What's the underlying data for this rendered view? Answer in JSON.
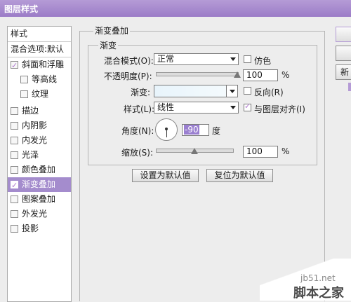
{
  "window": {
    "title": "图层样式"
  },
  "sidebar": {
    "header": "样式",
    "blend_options": "混合选项:默认",
    "items": [
      {
        "label": "斜面和浮雕",
        "checked": true
      },
      {
        "label": "等高线",
        "checked": false
      },
      {
        "label": "纹理",
        "checked": false
      },
      {
        "label": "描边",
        "checked": false
      },
      {
        "label": "内阴影",
        "checked": false
      },
      {
        "label": "内发光",
        "checked": false
      },
      {
        "label": "光泽",
        "checked": false
      },
      {
        "label": "颜色叠加",
        "checked": false
      },
      {
        "label": "渐变叠加",
        "checked": true,
        "selected": true
      },
      {
        "label": "图案叠加",
        "checked": false
      },
      {
        "label": "外发光",
        "checked": false
      },
      {
        "label": "投影",
        "checked": false
      }
    ]
  },
  "panel": {
    "title": "渐变叠加",
    "subtitle": "渐变",
    "blend_mode_label": "混合模式(O):",
    "blend_mode_value": "正常",
    "dither_label": "仿色",
    "dither_checked": false,
    "opacity_label": "不透明度(P):",
    "opacity_value": "100",
    "opacity_unit": "%",
    "opacity_level": 1.0,
    "gradient_label": "渐变:",
    "gradient_color_start": "#e8f4fb",
    "gradient_color_end": "#f4fafd",
    "reverse_label": "反向(R)",
    "reverse_checked": false,
    "style_label": "样式(L):",
    "style_value": "线性",
    "align_label": "与图层对齐(I)",
    "align_checked": true,
    "angle_label": "角度(N):",
    "angle_value": "-90",
    "angle_unit": "度",
    "scale_label": "缩放(S):",
    "scale_value": "100",
    "scale_unit": "%",
    "scale_level": 0.5,
    "default_btn": "设置为默认值",
    "reset_btn": "复位为默认值"
  },
  "right_buttons": {
    "new_btn": "新"
  },
  "watermark": {
    "line1": "jb51.net",
    "line2": "脚本之家"
  },
  "colors": {
    "accent": "#a48ccd",
    "title_bar": "#9b7cc7"
  }
}
